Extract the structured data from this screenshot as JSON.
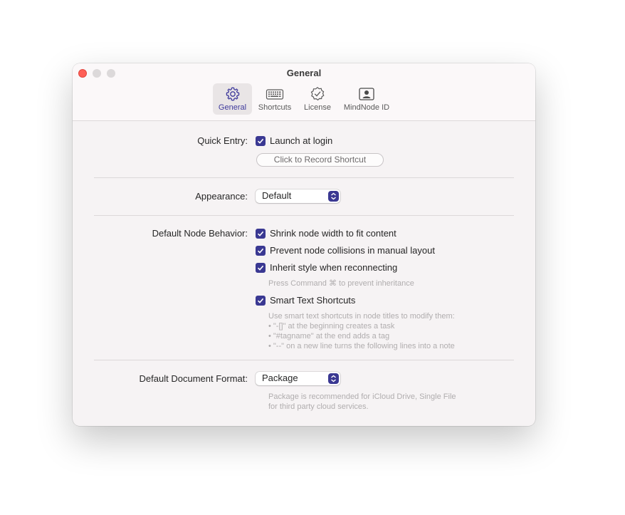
{
  "window": {
    "title": "General"
  },
  "tabs": [
    {
      "label": "General",
      "icon": "gear-icon",
      "active": true
    },
    {
      "label": "Shortcuts",
      "icon": "keyboard-icon",
      "active": false
    },
    {
      "label": "License",
      "icon": "verified-badge-icon",
      "active": false
    },
    {
      "label": "MindNode ID",
      "icon": "person-id-icon",
      "active": false
    }
  ],
  "quick_entry": {
    "label": "Quick Entry:",
    "launch_at_login": {
      "label": "Launch at login",
      "checked": true
    },
    "record_shortcut_label": "Click to Record Shortcut"
  },
  "appearance": {
    "label": "Appearance:",
    "selected": "Default"
  },
  "node_behavior": {
    "label": "Default Node Behavior:",
    "shrink_width": {
      "label": "Shrink node width to fit content",
      "checked": true
    },
    "prevent_collisions": {
      "label": "Prevent node collisions in manual layout",
      "checked": true
    },
    "inherit_style": {
      "label": "Inherit style when reconnecting",
      "checked": true
    },
    "inherit_hint": "Press Command ⌘ to prevent inheritance",
    "smart_text": {
      "label": "Smart Text Shortcuts",
      "checked": true
    },
    "smart_text_hint": [
      "Use smart text shortcuts in node titles to modify them:",
      "• \"-[]\" at the beginning creates a task",
      "• \"#tagname\" at the end adds a tag",
      "• \"--\" on a new line turns the following lines into a note"
    ]
  },
  "document_format": {
    "label": "Default Document Format:",
    "selected": "Package",
    "hint": [
      "Package is recommended for iCloud Drive, Single File",
      "for third party cloud services."
    ]
  },
  "colors": {
    "accent": "#3a3892",
    "close_button": "#fe5f57",
    "window_bg": "#f6f3f4"
  }
}
